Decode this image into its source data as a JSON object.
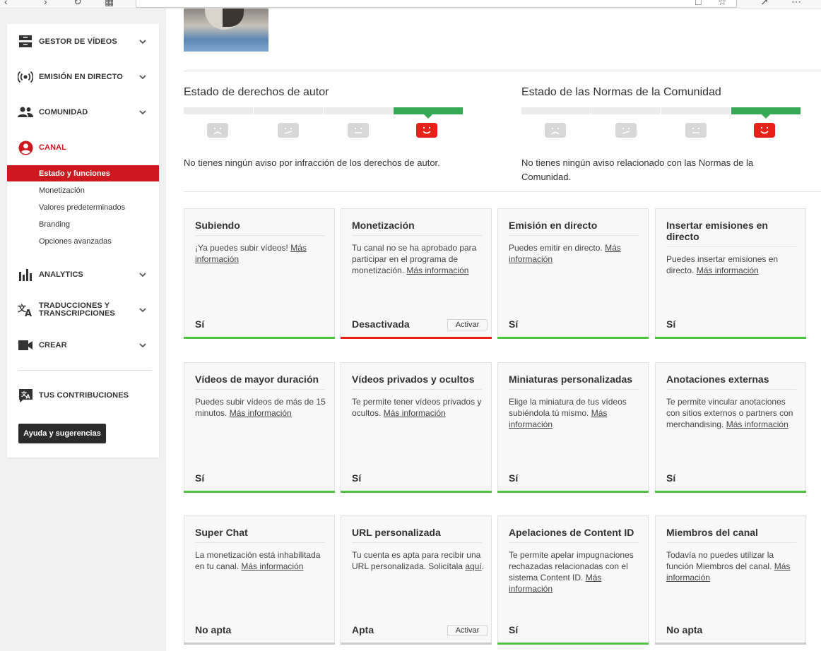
{
  "sidebar": {
    "nav": [
      {
        "label": "GESTOR DE VÍDEOS",
        "icon": "video-manager-icon"
      },
      {
        "label": "EMISIÓN EN DIRECTO",
        "icon": "live-stream-icon"
      },
      {
        "label": "COMUNIDAD",
        "icon": "community-icon"
      },
      {
        "label": "CANAL",
        "icon": "channel-icon"
      },
      {
        "label": "ANALYTICS",
        "icon": "analytics-icon"
      },
      {
        "label_line1": "TRADUCCIONES Y",
        "label_line2": "TRANSCRIPCIONES",
        "icon": "translate-icon"
      },
      {
        "label": "CREAR",
        "icon": "create-icon"
      },
      {
        "label": "TUS CONTRIBUCIONES",
        "icon": "contributions-icon"
      }
    ],
    "channel_sub": [
      "Estado y funciones",
      "Monetización",
      "Valores predeterminados",
      "Branding",
      "Opciones avanzadas"
    ],
    "help_button": "Ayuda y sugerencias",
    "accent_color": "#cc181e"
  },
  "copyright": {
    "title": "Estado de derechos de autor",
    "description": "No tienes ningún aviso por infracción de los derechos de autor."
  },
  "community": {
    "title": "Estado de las Normas de la Comunidad",
    "description_line1": "No tienes ningún aviso relacionado con las Normas de la",
    "description_line2": "Comunidad."
  },
  "link_text": "Más información",
  "cards": [
    {
      "title": "Subiendo",
      "desc": "¡Ya puedes subir vídeos!",
      "link": "Más información",
      "status": "Sí",
      "state": "green"
    },
    {
      "title": "Monetización",
      "desc": "Tu canal no se ha aprobado para participar en el programa de monetización.",
      "link": "Más información",
      "status": "Desactivada",
      "state": "red",
      "button": "Activar"
    },
    {
      "title": "Emisión en directo",
      "desc": "Puedes emitir en directo.",
      "link": "Más información",
      "status": "Sí",
      "state": "green"
    },
    {
      "title": "Insertar emisiones en directo",
      "desc": "Puedes insertar emisiones en directo.",
      "link": "Más información",
      "status": "Sí",
      "state": "green"
    },
    {
      "title": "Vídeos de mayor duración",
      "desc": "Puedes subir vídeos de más de 15 minutos.",
      "link": "Más información",
      "status": "Sí",
      "state": "green"
    },
    {
      "title": "Vídeos privados y ocultos",
      "desc": "Te permite tener vídeos privados y ocultos.",
      "link": "Más información",
      "status": "Sí",
      "state": "green"
    },
    {
      "title": "Miniaturas personalizadas",
      "desc": "Elige la miniatura de tus vídeos subiéndola tú mismo.",
      "link": "Más información",
      "status": "Sí",
      "state": "green"
    },
    {
      "title": "Anotaciones externas",
      "desc": "Te permite vincular anotaciones con sitios externos o partners con merchandising.",
      "link": "Más información",
      "status": "Sí",
      "state": "green"
    },
    {
      "title": "Super Chat",
      "desc": "La monetización está inhabilitada en tu canal.",
      "link": "Más información",
      "status": "No apta",
      "state": "gray"
    },
    {
      "title": "URL personalizada",
      "desc": "Tu cuenta es apta para recibir una URL personalizada. Solicítala",
      "link": "aquí",
      "tail": ".",
      "status": "Apta",
      "state": "gray",
      "button": "Activar"
    },
    {
      "title": "Apelaciones de Content ID",
      "desc": "Te permite apelar impugnaciones rechazadas relacionadas con el sistema Content ID.",
      "link": "Más información",
      "status": "Sí",
      "state": "green"
    },
    {
      "title": "Miembros del canal",
      "desc": "Todavía no puedes utilizar la función Miembros del canal.",
      "link": "Más información",
      "status": "No apta",
      "state": "gray"
    }
  ],
  "colors": {
    "good": "#4ec33f",
    "bad": "#e62117",
    "neutral": "#cccccc",
    "meter_green": "#34a853"
  }
}
